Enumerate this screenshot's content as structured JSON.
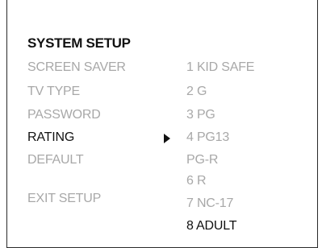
{
  "menu": {
    "title": "SYSTEM SETUP",
    "items": [
      {
        "label": "SCREEN SAVER",
        "selected": false
      },
      {
        "label": "TV TYPE",
        "selected": false
      },
      {
        "label": "PASSWORD",
        "selected": false
      },
      {
        "label": "RATING",
        "selected": true
      },
      {
        "label": "DEFAULT",
        "selected": false
      },
      {
        "label": "EXIT SETUP",
        "selected": false
      }
    ]
  },
  "submenu": {
    "indicator_icon": "triangle-right-icon",
    "options": [
      {
        "label": "1 KID SAFE",
        "selected": false
      },
      {
        "label": "2 G",
        "selected": false
      },
      {
        "label": "3 PG",
        "selected": false
      },
      {
        "label": "4 PG13",
        "selected": false
      },
      {
        "label": "PG-R",
        "selected": false
      },
      {
        "label": "6 R",
        "selected": false
      },
      {
        "label": "7 NC-17",
        "selected": false
      },
      {
        "label": "8 ADULT",
        "selected": true
      }
    ]
  },
  "colors": {
    "active_text": "#111111",
    "inactive_text": "#a8a8a8",
    "background": "#ffffff",
    "border": "#2a2a2a"
  }
}
